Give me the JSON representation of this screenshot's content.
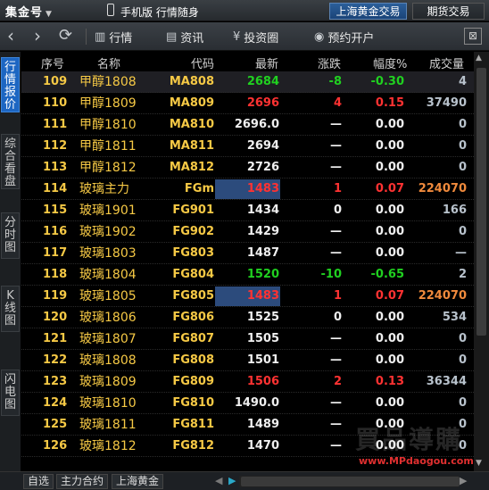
{
  "app": {
    "logo": "集金号",
    "mobile_label": "手机版 行情随身",
    "top_tabs": [
      "上海黄金交易",
      "期货交易"
    ]
  },
  "nav": {
    "back": "‹",
    "forward": "›",
    "items": [
      "行情",
      "资讯",
      "投资圈",
      "预约开户"
    ]
  },
  "side_tabs": [
    "行情报价",
    "综合看盘",
    "分时图",
    "K线图",
    "闪电图"
  ],
  "table": {
    "headers": [
      "序号",
      "名称",
      "代码",
      "最新",
      "涨跌",
      "幅度%",
      "成交量"
    ],
    "rows": [
      {
        "idx": "109",
        "name": "甲醇1808",
        "code": "MA808",
        "last": "2684",
        "chg": "-8",
        "pct": "-0.30",
        "vol": "4",
        "lc": "green",
        "cc": "green",
        "pc": "green",
        "vc": "gray",
        "hl": false
      },
      {
        "idx": "110",
        "name": "甲醇1809",
        "code": "MA809",
        "last": "2696",
        "chg": "4",
        "pct": "0.15",
        "vol": "37490",
        "lc": "red",
        "cc": "red",
        "pc": "red",
        "vc": "gray",
        "hl": false
      },
      {
        "idx": "111",
        "name": "甲醇1810",
        "code": "MA810",
        "last": "2696.0",
        "chg": "—",
        "pct": "0.00",
        "vol": "0",
        "lc": "white",
        "cc": "white",
        "pc": "white",
        "vc": "gray",
        "hl": false
      },
      {
        "idx": "112",
        "name": "甲醇1811",
        "code": "MA811",
        "last": "2694",
        "chg": "—",
        "pct": "0.00",
        "vol": "0",
        "lc": "white",
        "cc": "white",
        "pc": "white",
        "vc": "gray",
        "hl": false
      },
      {
        "idx": "113",
        "name": "甲醇1812",
        "code": "MA812",
        "last": "2726",
        "chg": "—",
        "pct": "0.00",
        "vol": "0",
        "lc": "white",
        "cc": "white",
        "pc": "white",
        "vc": "gray",
        "hl": false
      },
      {
        "idx": "114",
        "name": "玻璃主力",
        "code": "FGm",
        "last": "1483",
        "chg": "1",
        "pct": "0.07",
        "vol": "224070",
        "lc": "red",
        "cc": "red",
        "pc": "red",
        "vc": "orange",
        "hl": true
      },
      {
        "idx": "115",
        "name": "玻璃1901",
        "code": "FG901",
        "last": "1434",
        "chg": "0",
        "pct": "0.00",
        "vol": "166",
        "lc": "white",
        "cc": "white",
        "pc": "white",
        "vc": "gray",
        "hl": false
      },
      {
        "idx": "116",
        "name": "玻璃1902",
        "code": "FG902",
        "last": "1429",
        "chg": "—",
        "pct": "0.00",
        "vol": "0",
        "lc": "white",
        "cc": "white",
        "pc": "white",
        "vc": "gray",
        "hl": false
      },
      {
        "idx": "117",
        "name": "玻璃1803",
        "code": "FG803",
        "last": "1487",
        "chg": "—",
        "pct": "0.00",
        "vol": "—",
        "lc": "white",
        "cc": "white",
        "pc": "white",
        "vc": "gray",
        "hl": false
      },
      {
        "idx": "118",
        "name": "玻璃1804",
        "code": "FG804",
        "last": "1520",
        "chg": "-10",
        "pct": "-0.65",
        "vol": "2",
        "lc": "green",
        "cc": "green",
        "pc": "green",
        "vc": "gray",
        "hl": false
      },
      {
        "idx": "119",
        "name": "玻璃1805",
        "code": "FG805",
        "last": "1483",
        "chg": "1",
        "pct": "0.07",
        "vol": "224070",
        "lc": "red",
        "cc": "red",
        "pc": "red",
        "vc": "orange",
        "hl": true
      },
      {
        "idx": "120",
        "name": "玻璃1806",
        "code": "FG806",
        "last": "1525",
        "chg": "0",
        "pct": "0.00",
        "vol": "534",
        "lc": "white",
        "cc": "white",
        "pc": "white",
        "vc": "gray",
        "hl": false
      },
      {
        "idx": "121",
        "name": "玻璃1807",
        "code": "FG807",
        "last": "1505",
        "chg": "—",
        "pct": "0.00",
        "vol": "0",
        "lc": "white",
        "cc": "white",
        "pc": "white",
        "vc": "gray",
        "hl": false
      },
      {
        "idx": "122",
        "name": "玻璃1808",
        "code": "FG808",
        "last": "1501",
        "chg": "—",
        "pct": "0.00",
        "vol": "0",
        "lc": "white",
        "cc": "white",
        "pc": "white",
        "vc": "gray",
        "hl": false
      },
      {
        "idx": "123",
        "name": "玻璃1809",
        "code": "FG809",
        "last": "1506",
        "chg": "2",
        "pct": "0.13",
        "vol": "36344",
        "lc": "red",
        "cc": "red",
        "pc": "red",
        "vc": "gray",
        "hl": false
      },
      {
        "idx": "124",
        "name": "玻璃1810",
        "code": "FG810",
        "last": "1490.0",
        "chg": "—",
        "pct": "0.00",
        "vol": "0",
        "lc": "white",
        "cc": "white",
        "pc": "white",
        "vc": "gray",
        "hl": false
      },
      {
        "idx": "125",
        "name": "玻璃1811",
        "code": "FG811",
        "last": "1489",
        "chg": "—",
        "pct": "0.00",
        "vol": "0",
        "lc": "white",
        "cc": "white",
        "pc": "white",
        "vc": "gray",
        "hl": false
      },
      {
        "idx": "126",
        "name": "玻璃1812",
        "code": "FG812",
        "last": "1470",
        "chg": "—",
        "pct": "0.00",
        "vol": "0",
        "lc": "white",
        "cc": "white",
        "pc": "white",
        "vc": "gray",
        "hl": false
      }
    ]
  },
  "bottom_tabs": [
    "自选",
    "主力合约",
    "上海黄金"
  ],
  "watermark": {
    "logo": "買品導購",
    "url": "www.MPdaogou.com"
  }
}
